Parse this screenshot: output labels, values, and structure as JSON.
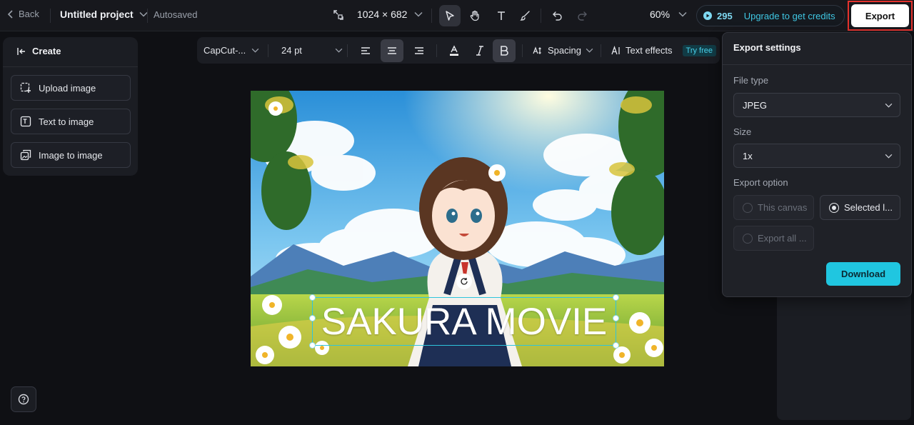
{
  "header": {
    "back_label": "Back",
    "project_name": "Untitled project",
    "autosave_status": "Autosaved",
    "canvas_size": "1024 × 682",
    "zoom_level": "60%",
    "credits_count": "295",
    "upgrade_label": "Upgrade to get credits",
    "export_label": "Export"
  },
  "sidebar": {
    "create_label": "Create",
    "items": [
      {
        "label": "Upload image",
        "icon": "upload-image-icon"
      },
      {
        "label": "Text to image",
        "icon": "text-to-image-icon"
      },
      {
        "label": "Image to image",
        "icon": "image-to-image-icon"
      }
    ]
  },
  "text_toolbar": {
    "font_family": "CapCut-...",
    "font_size": "24 pt",
    "spacing_label": "Spacing",
    "text_effects_label": "Text effects",
    "try_free_badge": "Try free"
  },
  "canvas": {
    "text_layer": "SAKURA MOVIE"
  },
  "export_settings": {
    "title": "Export settings",
    "file_type_label": "File type",
    "file_type_value": "JPEG",
    "size_label": "Size",
    "size_value": "1x",
    "export_option_label": "Export option",
    "options": [
      {
        "label": "This canvas",
        "selected": false
      },
      {
        "label": "Selected l...",
        "selected": true
      },
      {
        "label": "Export all ...",
        "selected": false
      }
    ],
    "download_label": "Download"
  },
  "colors": {
    "accent": "#20c6e0",
    "background": "#0f1014",
    "panel": "#1b1d23",
    "export_highlight": "#e5322d"
  }
}
